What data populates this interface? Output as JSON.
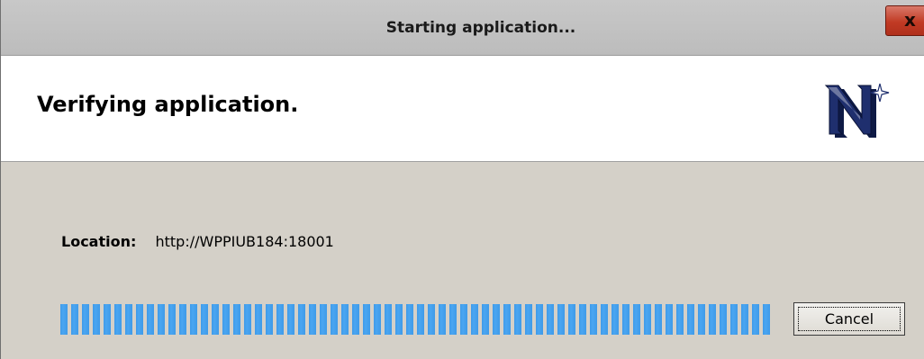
{
  "window": {
    "title": "Starting application...",
    "close_label": "x"
  },
  "header": {
    "heading": "Verifying application.",
    "logo_icon": "application-n-logo-icon"
  },
  "details": {
    "location_label": "Location:",
    "location_value": "http://WPPIUB184:18001"
  },
  "progress": {
    "value": 1.0
  },
  "actions": {
    "cancel_label": "Cancel"
  },
  "colors": {
    "progress_accent": "#3f9ae8",
    "close_button": "#c13a24",
    "dialog_background": "#d4d0c8",
    "logo_blue": "#1f2f6e"
  }
}
